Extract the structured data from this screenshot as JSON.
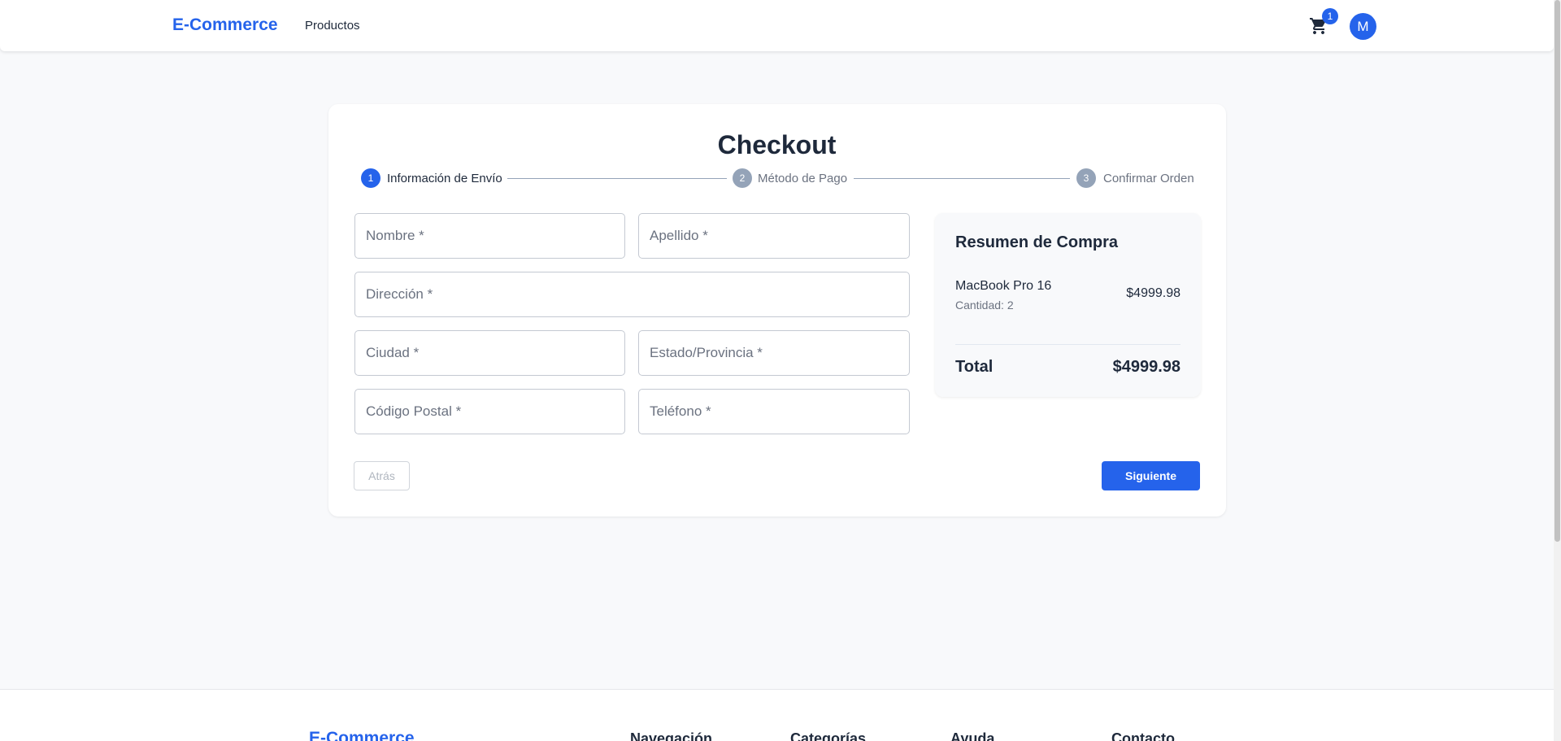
{
  "header": {
    "brand": "E-Commerce",
    "nav_products": "Productos",
    "cart_count": "1",
    "avatar_initial": "M"
  },
  "checkout": {
    "title": "Checkout",
    "steps": [
      {
        "number": "1",
        "label": "Información de Envío",
        "active": true
      },
      {
        "number": "2",
        "label": "Método de Pago",
        "active": false
      },
      {
        "number": "3",
        "label": "Confirmar Orden",
        "active": false
      }
    ],
    "fields": {
      "nombre": "Nombre *",
      "apellido": "Apellido *",
      "direccion": "Dirección *",
      "ciudad": "Ciudad *",
      "estado": "Estado/Provincia *",
      "codigo_postal": "Código Postal *",
      "telefono": "Teléfono *"
    },
    "back_label": "Atrás",
    "next_label": "Siguiente"
  },
  "summary": {
    "title": "Resumen de Compra",
    "item_name": "MacBook Pro 16",
    "item_quantity": "Cantidad: 2",
    "item_price": "$4999.98",
    "total_label": "Total",
    "total_value": "$4999.98"
  },
  "footer": {
    "brand": "E-Commerce",
    "headings": [
      "Navegación",
      "Categorías",
      "Ayuda",
      "Contacto"
    ]
  },
  "colors": {
    "accent": "#2563eb",
    "inactive_step": "#94a3b8",
    "background": "#f8f9fb"
  }
}
